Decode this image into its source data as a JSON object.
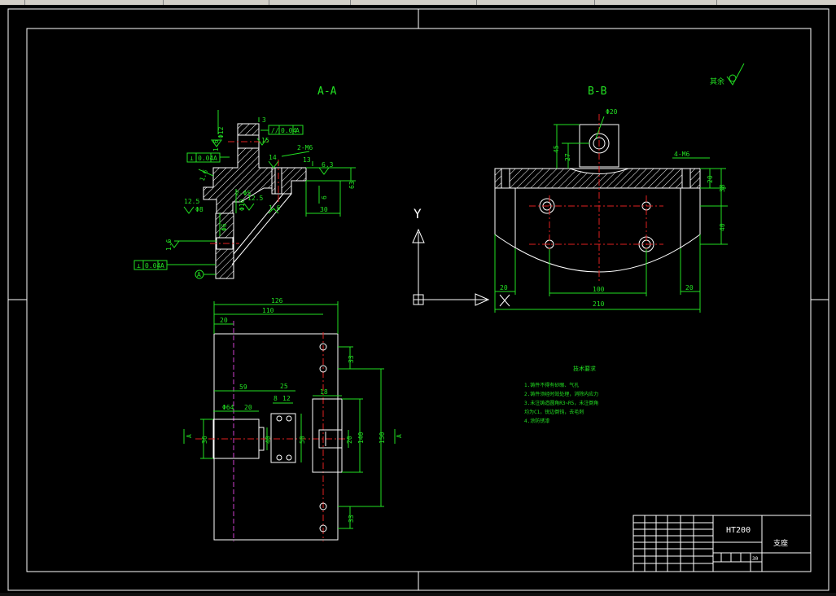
{
  "sheet": {
    "material": "HT200",
    "part_name": "支座",
    "title_block_small": "30"
  },
  "views": {
    "aa_label": "A-A",
    "bb_label": "B-B",
    "ucs_y": "Y",
    "roughness_other": "其余"
  },
  "dims_aa": {
    "d3": "3",
    "tol_parallel": "//",
    "tol_value": "0.04",
    "tol_datum": "A",
    "tol_perp_sym": "⊥",
    "tol_perp_value": "0.04",
    "tol_perp_datum": "A",
    "tol_perp2_value": "0.04",
    "r16a": "1.6",
    "r16b": "1.6",
    "r16c": "1.6",
    "r16d": "1.6",
    "r63": "6.3",
    "r125": "12.5",
    "r125b": "12.5",
    "d15": "15",
    "d14": "14",
    "d13": "13",
    "d6": "6",
    "d30": "30",
    "d63": "63",
    "h4m6": "2-M6",
    "h4m6b": "2-Φ5",
    "phi12": "Φ12",
    "phi10": "Φ10",
    "phi8": "Φ8",
    "phi6": "Φ6",
    "datum_a": "A"
  },
  "dims_bb": {
    "phi20": "Φ20",
    "d45": "45",
    "d27": "27",
    "m6": "4-M6",
    "d20r": "20",
    "d38": "38",
    "d40": "40",
    "d20l": "20",
    "d100": "100",
    "d20rb": "20",
    "d210": "210"
  },
  "dims_plan": {
    "d126": "126",
    "d110": "110",
    "d20": "20",
    "d59": "59",
    "d25": "25",
    "d64": "Φ64",
    "d20b": "20",
    "d8": "8",
    "d12": "12",
    "d18": "18",
    "d33a": "33",
    "d33b": "33",
    "d36": "36",
    "d40": "40",
    "d50": "50",
    "d20v": "20",
    "d140": "140",
    "d150": "150",
    "sec_a_left": "A",
    "sec_a_right": "A"
  },
  "tech_notes": {
    "title": "技术要求",
    "lines": [
      "1.铸件不得有砂眼、气孔",
      "2.铸件须经时效处理，消除内应力",
      "3.未注铸造圆角R3~R5，未注倒角",
      "均为C1，锐边倒钝，去毛刺",
      "4.涂防锈漆"
    ]
  }
}
